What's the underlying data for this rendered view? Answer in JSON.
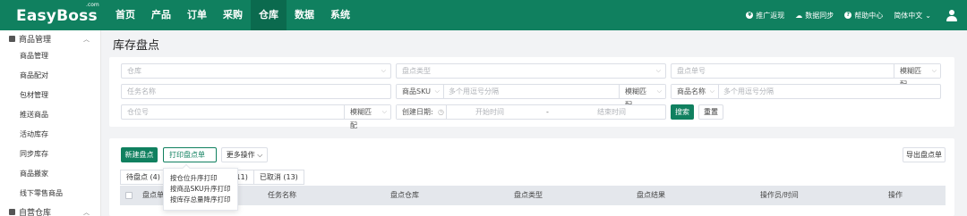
{
  "app": {
    "brand": "EasyBoss",
    "brand_suffix": ".com"
  },
  "topnav": {
    "items": [
      "首页",
      "产品",
      "订单",
      "采购",
      "仓库",
      "数据",
      "系统"
    ],
    "active_index": 4,
    "tools": {
      "promo": "推广返现",
      "sync": "数据同步",
      "help": "帮助中心",
      "lang": "简体中文"
    }
  },
  "sidebar": {
    "group1": "商品管理",
    "items": [
      "商品管理",
      "商品配对",
      "包材管理",
      "推送商品",
      "活动库存",
      "同步库存",
      "商品搬家",
      "线下零售商品"
    ],
    "group2": "自营仓库"
  },
  "page": {
    "title": "库存盘点"
  },
  "filters": {
    "warehouse": "仓库",
    "check_type": "盘点类型",
    "check_no": "盘点单号",
    "match_mode": "模糊匹配",
    "task_name": "任务名称",
    "sku_prefix": "商品SKU",
    "multi_placeholder": "多个用逗号分隔",
    "name_prefix": "商品名称",
    "location": "仓位号",
    "created_date": "创建日期:",
    "start_time": "开始时间",
    "range_sep": "-",
    "end_time": "结束时间",
    "search_btn": "搜索",
    "reset_btn": "重置"
  },
  "toolbar": {
    "new_check": "新建盘点",
    "print_check": "打印盘点单",
    "more_actions": "更多操作",
    "export": "导出盘点单"
  },
  "tabs": [
    {
      "label": "待盘点 (4)"
    },
    {
      "label": "已完成 (11)"
    },
    {
      "label": "已取消 (13)"
    }
  ],
  "table": {
    "headers": [
      "盘点单号",
      "任务名称",
      "盘点仓库",
      "盘点类型",
      "盘点结果",
      "操作员/时间",
      "操作"
    ]
  },
  "print_menu": {
    "items": [
      "按仓位升序打印",
      "按商品SKU升序打印",
      "按库存总量降序打印"
    ]
  },
  "colors": {
    "brand_green": "#10805f",
    "active_nav": "#0b6a4e"
  }
}
